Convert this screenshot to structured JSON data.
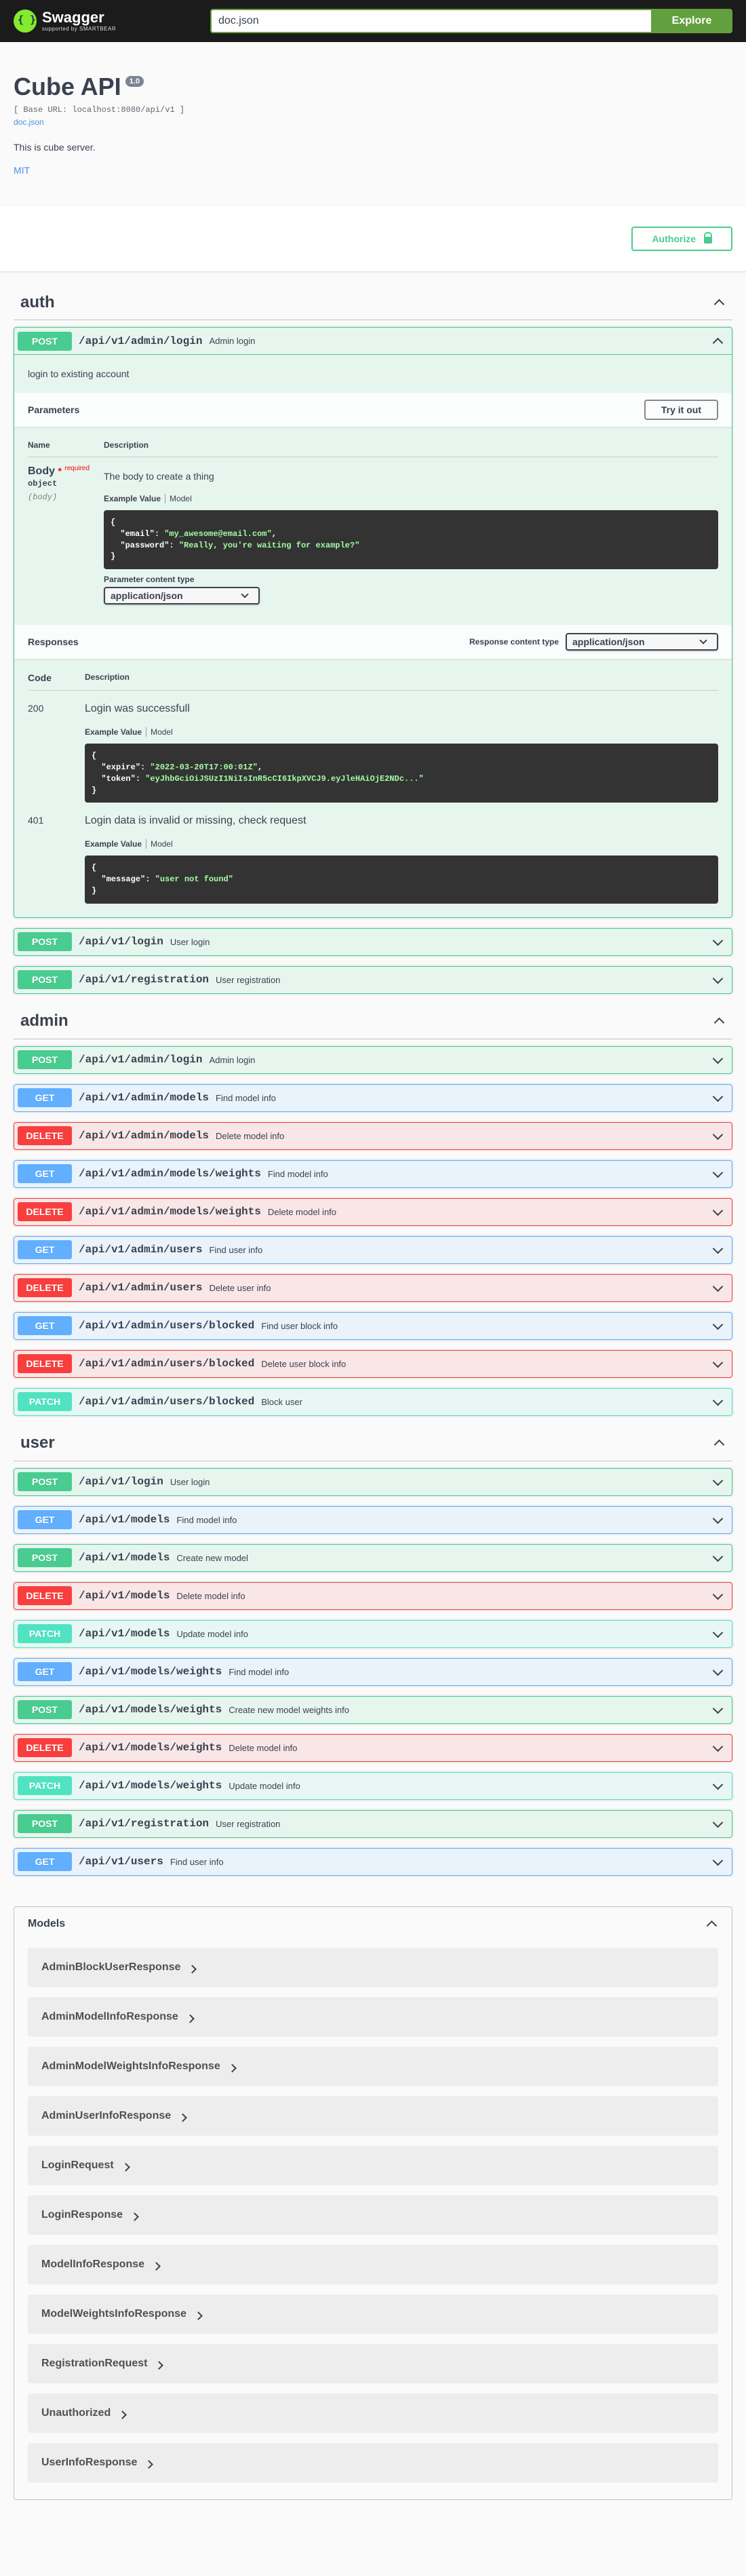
{
  "topbar": {
    "logo_name": "Swagger",
    "logo_sub": "supported by SMARTBEAR",
    "search_value": "doc.json",
    "explore_label": "Explore"
  },
  "info": {
    "title": "Cube API",
    "version": "1.0",
    "base_url": "[ Base URL: localhost:8080/api/v1 ]",
    "spec_link": "doc.json",
    "description": "This is cube server.",
    "license": "MIT"
  },
  "authorize_label": "Authorize",
  "tags": {
    "auth": {
      "name": "auth",
      "expanded_op": {
        "method": "POST",
        "path": "/api/v1/admin/login",
        "summary": "Admin login",
        "lead": "login to existing account",
        "parameters_title": "Parameters",
        "try_label": "Try it out",
        "col_name": "Name",
        "col_desc": "Description",
        "param_name": "Body",
        "param_star": "*",
        "param_required": "required",
        "param_type": "object",
        "param_in": "(body)",
        "param_desc": "The body to create a thing",
        "example_label": "Example Value",
        "model_label": "Model",
        "content_type_label": "Parameter content type",
        "content_type_value": "application/json",
        "responses_title": "Responses",
        "response_ct_label": "Response content type",
        "response_ct_value": "application/json",
        "resp_col_code": "Code",
        "resp_col_desc": "Description",
        "responses": [
          {
            "code": "200",
            "desc": "Login was successfull"
          },
          {
            "code": "401",
            "desc": "Login data is invalid or missing, check request"
          }
        ]
      },
      "ops": [
        {
          "method": "POST",
          "path": "/api/v1/login",
          "summary": "User login"
        },
        {
          "method": "POST",
          "path": "/api/v1/registration",
          "summary": "User registration"
        }
      ]
    },
    "admin": {
      "name": "admin",
      "ops": [
        {
          "method": "POST",
          "path": "/api/v1/admin/login",
          "summary": "Admin login"
        },
        {
          "method": "GET",
          "path": "/api/v1/admin/models",
          "summary": "Find model info"
        },
        {
          "method": "DELETE",
          "path": "/api/v1/admin/models",
          "summary": "Delete model info"
        },
        {
          "method": "GET",
          "path": "/api/v1/admin/models/weights",
          "summary": "Find model info"
        },
        {
          "method": "DELETE",
          "path": "/api/v1/admin/models/weights",
          "summary": "Delete model info"
        },
        {
          "method": "GET",
          "path": "/api/v1/admin/users",
          "summary": "Find user info"
        },
        {
          "method": "DELETE",
          "path": "/api/v1/admin/users",
          "summary": "Delete user info"
        },
        {
          "method": "GET",
          "path": "/api/v1/admin/users/blocked",
          "summary": "Find user block info"
        },
        {
          "method": "DELETE",
          "path": "/api/v1/admin/users/blocked",
          "summary": "Delete user block info"
        },
        {
          "method": "PATCH",
          "path": "/api/v1/admin/users/blocked",
          "summary": "Block user"
        }
      ]
    },
    "user": {
      "name": "user",
      "ops": [
        {
          "method": "POST",
          "path": "/api/v1/login",
          "summary": "User login"
        },
        {
          "method": "GET",
          "path": "/api/v1/models",
          "summary": "Find model info"
        },
        {
          "method": "POST",
          "path": "/api/v1/models",
          "summary": "Create new model"
        },
        {
          "method": "DELETE",
          "path": "/api/v1/models",
          "summary": "Delete model info"
        },
        {
          "method": "PATCH",
          "path": "/api/v1/models",
          "summary": "Update model info"
        },
        {
          "method": "GET",
          "path": "/api/v1/models/weights",
          "summary": "Find model info"
        },
        {
          "method": "POST",
          "path": "/api/v1/models/weights",
          "summary": "Create new model weights info"
        },
        {
          "method": "DELETE",
          "path": "/api/v1/models/weights",
          "summary": "Delete model info"
        },
        {
          "method": "PATCH",
          "path": "/api/v1/models/weights",
          "summary": "Update model info"
        },
        {
          "method": "POST",
          "path": "/api/v1/registration",
          "summary": "User registration"
        },
        {
          "method": "GET",
          "path": "/api/v1/users",
          "summary": "Find user info"
        }
      ]
    }
  },
  "code_samples": {
    "request": [
      {
        "key": "\"email\"",
        "value": "\"my_awesome@email.com\""
      },
      {
        "key": "\"password\"",
        "value": "\"Really, you're waiting for example?\""
      }
    ],
    "resp200": [
      {
        "key": "\"expire\"",
        "value": "\"2022-03-20T17:00:01Z\""
      },
      {
        "key": "\"token\"",
        "value": "\"eyJhbGciOiJSUzI1NiIsInR5cCI6IkpXVCJ9.eyJleHAiOjE2NDc...\""
      }
    ],
    "resp401": [
      {
        "key": "\"message\"",
        "value": "\"user not found\""
      }
    ]
  },
  "models": {
    "title": "Models",
    "items": [
      "AdminBlockUserResponse",
      "AdminModelInfoResponse",
      "AdminModelWeightsInfoResponse",
      "AdminUserInfoResponse",
      "LoginRequest",
      "LoginResponse",
      "ModelInfoResponse",
      "ModelWeightsInfoResponse",
      "RegistrationRequest",
      "Unauthorized",
      "UserInfoResponse"
    ]
  }
}
